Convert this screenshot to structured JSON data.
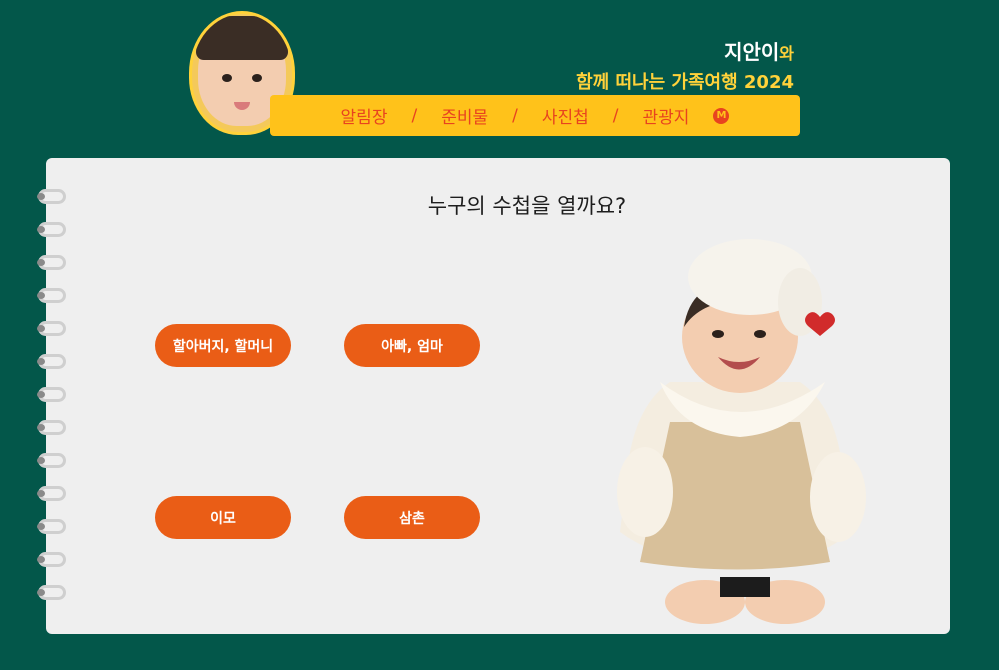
{
  "header": {
    "name": "지안이",
    "name_suffix": "와",
    "subtitle": "함께 떠나는 가족여행 2024",
    "nav": [
      {
        "label": "알림장"
      },
      {
        "label": "준비물"
      },
      {
        "label": "사진첩"
      },
      {
        "label": "관광지"
      }
    ],
    "separator": "/",
    "map_badge": "M"
  },
  "main": {
    "question": "누구의 수첩을 열까요?",
    "buttons": [
      {
        "label": "할아버지, 할머니"
      },
      {
        "label": "아빠, 엄마"
      },
      {
        "label": "이모"
      },
      {
        "label": "삼촌"
      }
    ]
  },
  "colors": {
    "background": "#03574a",
    "accent_yellow": "#ffc21a",
    "button_orange": "#ea5d16",
    "nav_text": "#e8431f",
    "notebook": "#efefef"
  }
}
